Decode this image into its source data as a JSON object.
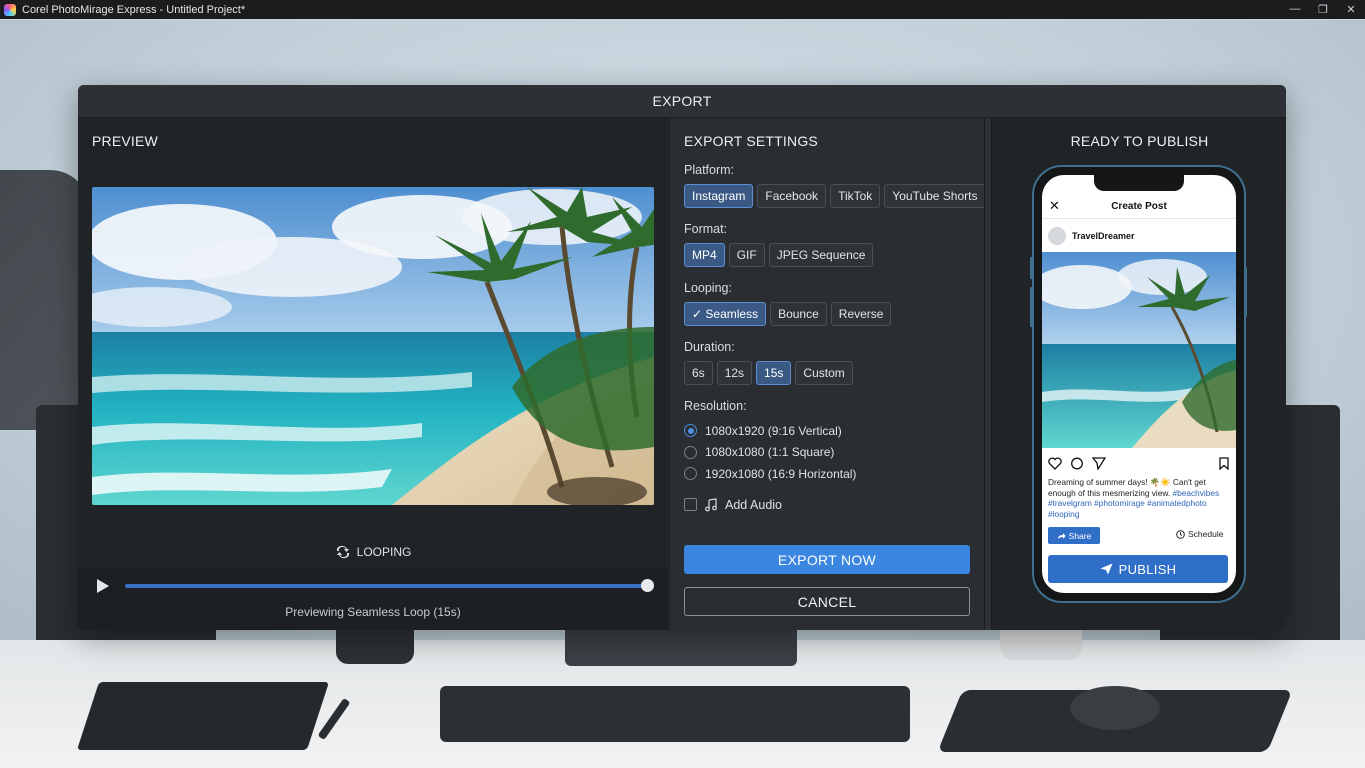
{
  "window": {
    "title": "Corel PhotoMirage Express - Untitled Project*",
    "controls": [
      "—",
      "❐",
      "✕"
    ]
  },
  "dialog": {
    "title": "EXPORT"
  },
  "preview": {
    "title": "PREVIEW",
    "looping_label": "LOOPING",
    "caption": "Previewing Seamless Loop (15s)",
    "progress": 1.0
  },
  "settings": {
    "title": "EXPORT SETTINGS",
    "platform": {
      "label": "Platform:",
      "options": [
        "Instagram",
        "Facebook",
        "TikTok",
        "YouTube Shorts"
      ],
      "selected": "Instagram"
    },
    "format": {
      "label": "Format:",
      "options": [
        "MP4",
        "GIF",
        "JPEG Sequence"
      ],
      "selected": "MP4"
    },
    "looping": {
      "label": "Looping:",
      "options": [
        "✓ Seamless",
        "Bounce",
        "Reverse"
      ],
      "selected": "✓ Seamless"
    },
    "duration": {
      "label": "Duration:",
      "options": [
        "6s",
        "12s",
        "15s",
        "Custom"
      ],
      "selected": "15s"
    },
    "resolution": {
      "label": "Resolution:",
      "options": [
        "1080x1920 (9:16 Vertical)",
        "1080x1080 (1:1 Square)",
        "1920x1080 (16:9 Horizontal)"
      ],
      "selected": "1080x1920 (9:16 Vertical)"
    },
    "add_audio_label": "Add Audio",
    "add_audio_checked": false,
    "export_label": "EXPORT NOW",
    "cancel_label": "CANCEL"
  },
  "publish": {
    "title": "READY TO PUBLISH",
    "post": {
      "header": "Create Post",
      "close": "✕",
      "username": "TravelDreamer",
      "caption": "Dreaming of summer days! 🌴☀️ Can't get enough of this mesmerizing view.",
      "hashtags": "#beachvibes #travelgram #photomirage #animatedphoto #looping",
      "share_label": "Share",
      "schedule_label": "Schedule",
      "publish_label": "PUBLISH"
    }
  },
  "colors": {
    "accent": "#3a86e0",
    "selected_chip": "#3a5a85",
    "dialog_bg": "#26292d",
    "ig_blue": "#2f6fc7"
  }
}
